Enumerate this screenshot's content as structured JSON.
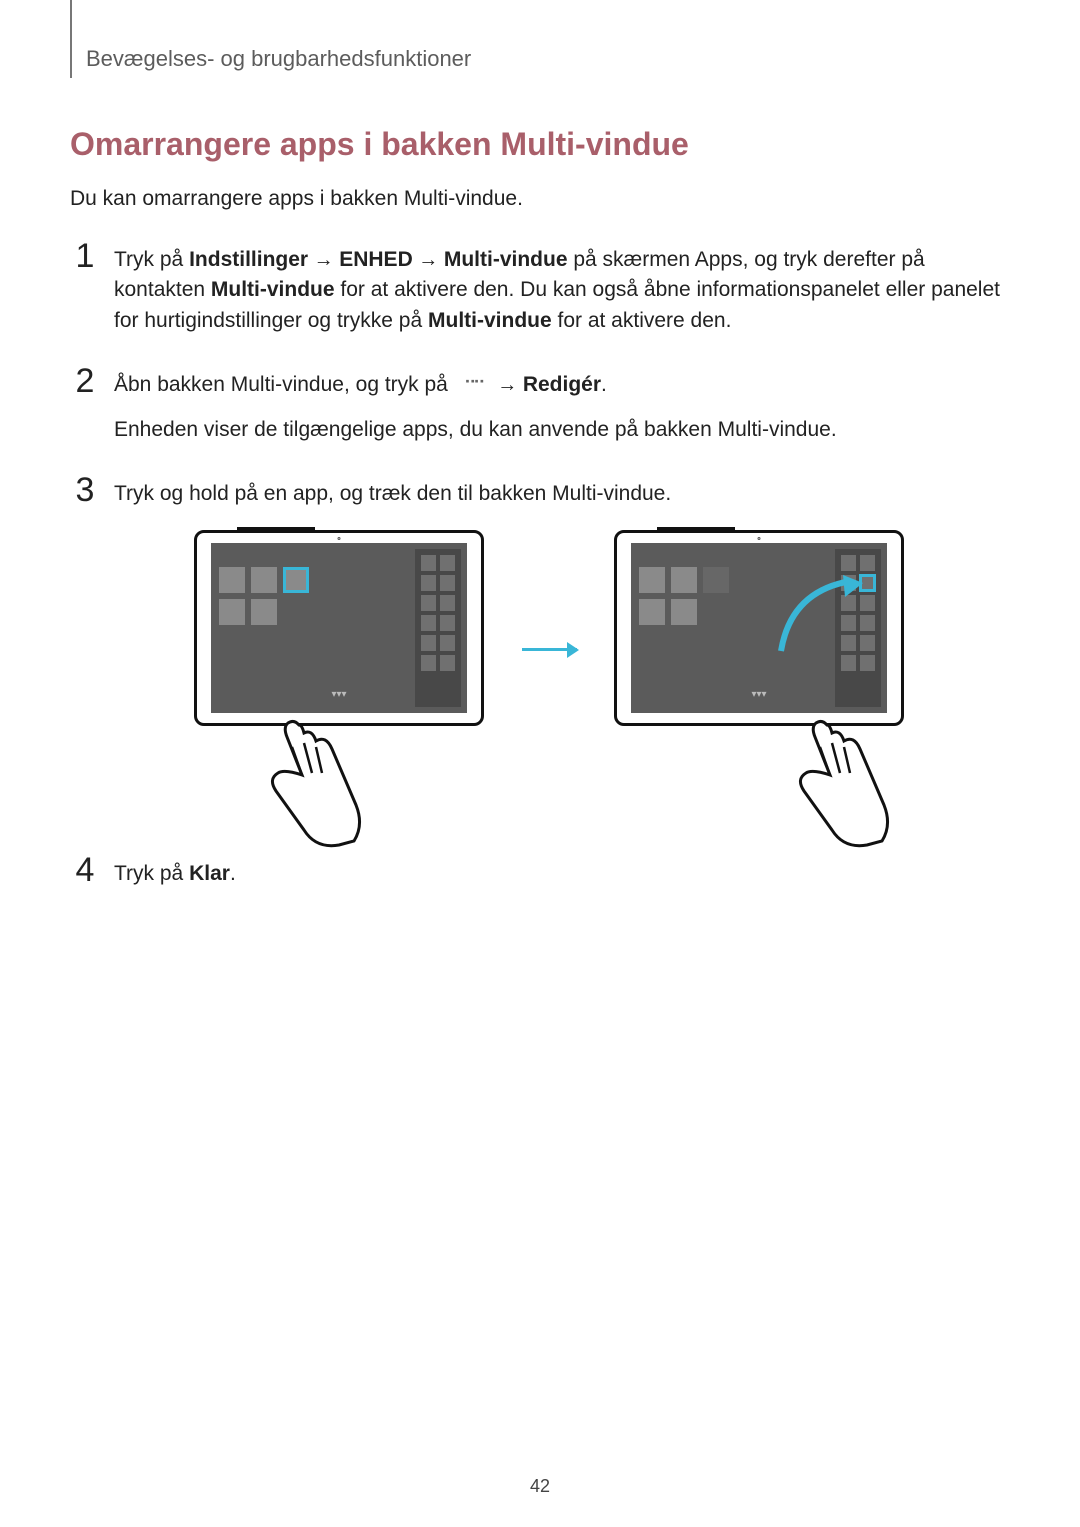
{
  "header": {
    "chapter": "Bevægelses- og brugbarhedsfunktioner"
  },
  "section": {
    "title": "Omarrangere apps i bakken Multi-vindue"
  },
  "intro": "Du kan omarrangere apps i bakken Multi-vindue.",
  "steps": {
    "one": {
      "tryk_pa": "Tryk på ",
      "indstillinger": "Indstillinger",
      "arrow": " → ",
      "enhed": "ENHED",
      "multi_vindue": "Multi-vindue",
      "after_path": " på skærmen Apps, og tryk derefter på kontakten ",
      "kontakt": "Multi-vindue",
      "after_kontakt": " for at aktivere den. Du kan også åbne informationspanelet eller panelet for hurtigindstillinger og trykke på ",
      "mv2": "Multi-vindue",
      "tail": " for at aktivere den."
    },
    "two": {
      "line1_pre": "Åbn bakken Multi-vindue, og tryk på ",
      "line1_arrow": " → ",
      "rediger": "Redigér",
      "line1_tail": ".",
      "line2": "Enheden viser de tilgængelige apps, du kan anvende på bakken Multi-vindue."
    },
    "three": {
      "text": "Tryk og hold på en app, og træk den til bakken Multi-vindue."
    },
    "four": {
      "pre": "Tryk på ",
      "klar": "Klar",
      "tail": "."
    }
  },
  "nums": {
    "one": "1",
    "two": "2",
    "three": "3",
    "four": "4"
  },
  "page": "42"
}
